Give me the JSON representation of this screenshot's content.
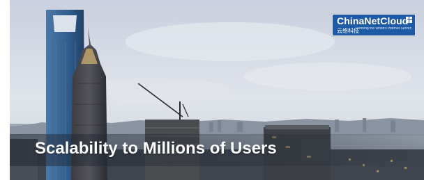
{
  "banner": {
    "headline": "Scalability to Millions of Users"
  },
  "logo": {
    "name": "ChinaNetCloud",
    "subtitle_cn": "云络科技",
    "subtitle_en": "Running the World's Internet Servers",
    "color": "#1f5aa6"
  },
  "scene": {
    "sky_top": "#cfd6e4",
    "sky_bottom": "#e9ecef",
    "tower_color": "#3b5f86"
  }
}
